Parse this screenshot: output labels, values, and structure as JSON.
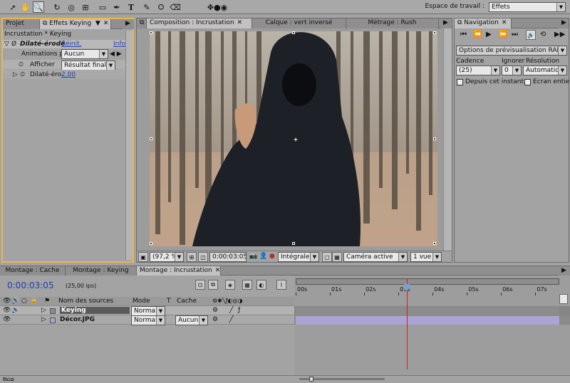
{
  "toolbar": {
    "workspace_label": "Espace de travail :",
    "workspace_value": "Effets"
  },
  "left_panel": {
    "tabs": [
      {
        "label": "Projet"
      },
      {
        "label": "Effets Keying"
      }
    ],
    "breadcrumb": "Incrustation * Keying",
    "effect_name": "Dilaté-érodé",
    "reset_label": "Réinit.",
    "info_label": "Info",
    "animations_label": "Animations pr",
    "animations_value": "Aucun",
    "show_label": "Afficher",
    "show_value": "Résultat final",
    "dilate_label": "Dilaté-éro",
    "dilate_value": "2,00"
  },
  "comp_panel": {
    "tabs": [
      {
        "label": "Composition : Incrustation"
      },
      {
        "label": "Calque : vert inversé"
      },
      {
        "label": "Métrage : Rush"
      }
    ],
    "zoom": "(97,2 %)",
    "timecode": "0:00:03:05",
    "resolution": "Intégrale",
    "camera": "Caméra active",
    "views": "1 vue"
  },
  "nav_panel": {
    "tab": "Navigation",
    "ram_preview": "Options de prévisualisation RAM",
    "cadence_label": "Cadence",
    "ignore_label": "Ignorer",
    "resolution_label": "Résolution",
    "cadence_value": "(25)",
    "ignore_value": "0",
    "resolution_value": "Automatique",
    "from_current": "Depuis cet instant",
    "fullscreen": "Ecran entier"
  },
  "timeline": {
    "tabs": [
      {
        "label": "Montage : Cache"
      },
      {
        "label": "Montage : Keying"
      },
      {
        "label": "Montage : Incrustation"
      }
    ],
    "timecode": "0:00:03:05",
    "fps": "(25,00 ips)",
    "col_source": "Nom des sources",
    "col_mode": "Mode",
    "col_t": "T",
    "col_cache": "Cache",
    "ruler": [
      "00s",
      "01s",
      "02s",
      "03s",
      "04s",
      "05s",
      "06s",
      "07s"
    ],
    "playhead_seconds": 3.2,
    "duration_seconds": 7.7,
    "layers": [
      {
        "index": "1",
        "name": "Keying",
        "mode": "Normal",
        "cache": "",
        "color": "#8c8c8c"
      },
      {
        "index": "2",
        "name": "Décor.JPG",
        "mode": "Normal",
        "cache": "Aucun",
        "color": "#a9a4d3"
      }
    ]
  },
  "colors": {
    "panel_bg": "#a3a3a3",
    "accent_border": "#e7b84a",
    "playhead": "#d02020",
    "link_blue": "#1a3fb8"
  }
}
